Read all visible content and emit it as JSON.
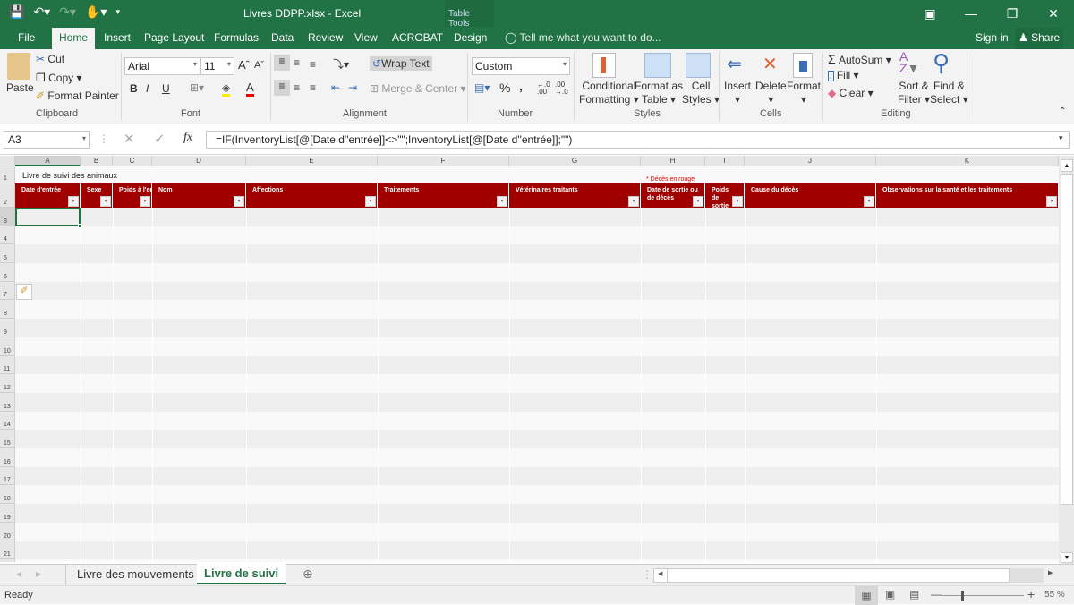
{
  "window": {
    "title": "Livres DDPP.xlsx - Excel",
    "context_tab_group": "Table Tools"
  },
  "quick_access": [
    "save-icon",
    "undo-icon",
    "redo-icon",
    "touch-mode-icon",
    "customize-icon"
  ],
  "tabs": [
    {
      "label": "File"
    },
    {
      "label": "Home",
      "active": true
    },
    {
      "label": "Insert"
    },
    {
      "label": "Page Layout"
    },
    {
      "label": "Formulas"
    },
    {
      "label": "Data"
    },
    {
      "label": "Review"
    },
    {
      "label": "View"
    },
    {
      "label": "ACROBAT"
    },
    {
      "label": "Design"
    }
  ],
  "tell_me": "Tell me what you want to do...",
  "sign_in": "Sign in",
  "share": "Share",
  "ribbon": {
    "clipboard": {
      "paste": "Paste",
      "cut": "Cut",
      "copy": "Copy",
      "format_painter": "Format Painter",
      "label": "Clipboard"
    },
    "font": {
      "name": "Arial",
      "size": "11",
      "label": "Font",
      "bold": "B",
      "italic": "I",
      "underline": "U"
    },
    "alignment": {
      "wrap_text": "Wrap Text",
      "merge_center": "Merge & Center",
      "label": "Alignment"
    },
    "number": {
      "format": "Custom",
      "label": "Number",
      "percent": "%",
      "comma": ","
    },
    "styles": {
      "conditional1": "Conditional",
      "conditional2": "Formatting",
      "format_table1": "Format as",
      "format_table2": "Table",
      "cell_styles1": "Cell",
      "cell_styles2": "Styles",
      "label": "Styles"
    },
    "cells": {
      "insert": "Insert",
      "delete": "Delete",
      "format": "Format",
      "label": "Cells"
    },
    "editing": {
      "autosum": "AutoSum",
      "fill": "Fill",
      "clear": "Clear",
      "sort1": "Sort &",
      "sort2": "Filter",
      "find1": "Find &",
      "find2": "Select",
      "label": "Editing"
    }
  },
  "formula_bar": {
    "name_box": "A3",
    "formula": "=IF(InventoryList[@[Date d''entrée]]<>\"\";InventoryList[@[Date d''entrée]];\"\")"
  },
  "columns": [
    "A",
    "B",
    "C",
    "D",
    "E",
    "F",
    "G",
    "H",
    "I",
    "J",
    "K"
  ],
  "rows": [
    "1",
    "2",
    "3",
    "4",
    "5",
    "6",
    "7",
    "8",
    "9",
    "10",
    "11",
    "12",
    "13",
    "14",
    "15",
    "16",
    "17",
    "18",
    "19",
    "20",
    "21"
  ],
  "sheet": {
    "title": "Livre de suivi des animaux",
    "note": "* Décès en rouge",
    "headers": [
      "Date d'entrée",
      "Sexe",
      "Poids à l'entrée",
      "Nom",
      "Affections",
      "Traitements",
      "Vétérinaires traitants",
      "Date de sortie ou de décès",
      "Poids de sortie",
      "Cause du décès",
      "Observations sur la santé et les traitements"
    ]
  },
  "sheet_tabs": [
    {
      "label": "Livre des mouvements"
    },
    {
      "label": "Livre de suivi",
      "active": true
    }
  ],
  "status": {
    "ready": "Ready",
    "zoom": "55 %"
  }
}
